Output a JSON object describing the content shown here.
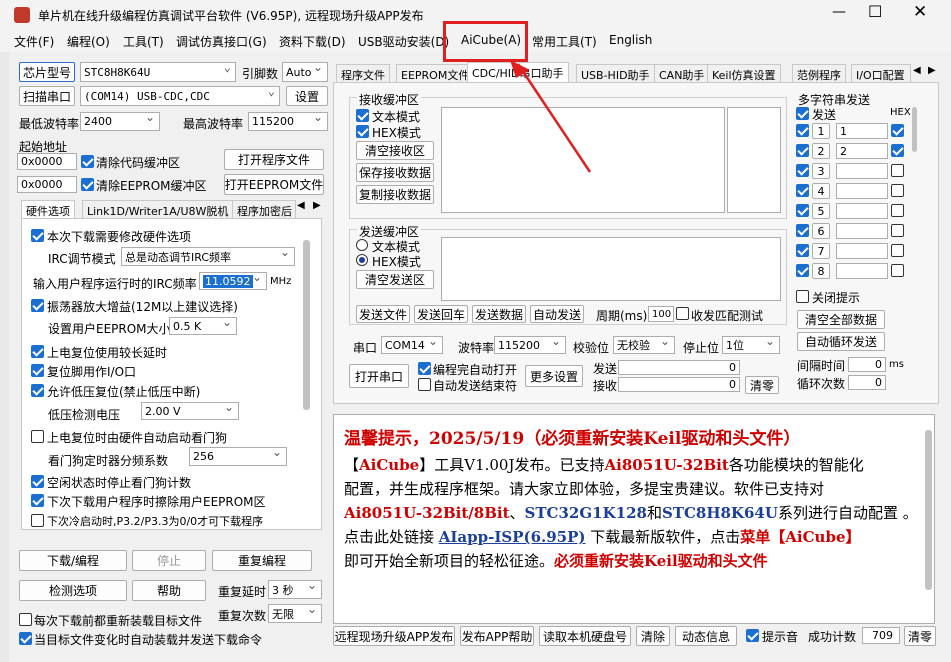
{
  "title": "单片机在线升级编程仿真调试平台软件 (V6.95P), 远程现场升级APP发布",
  "menu": [
    "文件(F)",
    "编程(O)",
    "工具(T)",
    "调试仿真接口(G)",
    "资料下载(D)",
    "USB驱动安装(D)",
    "AiCube(A)",
    "常用工具(T)",
    "English"
  ],
  "left": {
    "chip_btn": "芯片型号",
    "chip": "STC8H8K64U",
    "pin_lbl": "引脚数",
    "pin": "Auto",
    "scan_btn": "扫描串口",
    "port": "(COM14) USB-CDC,CDC",
    "settings_btn": "设置",
    "min_baud_lbl": "最低波特率",
    "min_baud": "2400",
    "max_baud_lbl": "最高波特率",
    "max_baud": "115200",
    "start_addr": "起始地址",
    "addr1": "0x0000",
    "clr_code": "清除代码缓冲区",
    "open_prog": "打开程序文件",
    "addr2": "0x0000",
    "clr_eeprom": "清除EEPROM缓冲区",
    "open_eeprom": "打开EEPROM文件",
    "tabs": [
      "硬件选项",
      "Link1D/Writer1A/U8W脱机",
      "程序加密后"
    ],
    "opt1": "本次下载需要修改硬件选项",
    "irc_lbl": "IRC调节模式",
    "irc": "总是动态调节IRC频率",
    "freq_lbl": "输入用户程序运行时的IRC频率",
    "freq": "11.0592",
    "mhz": "MHz",
    "opt_osc": "振荡器放大增益(12M以上建议选择)",
    "eep_lbl": "设置用户EEPROM大小",
    "eep": "0.5 K",
    "opt_reset": "上电复位使用较长延时",
    "opt_io": "复位脚用作I/O口",
    "opt_lv": "允许低压复位(禁止低压中断)",
    "lv_lbl": "低压检测电压",
    "lv": "2.00 V",
    "opt_wdt": "上电复位时由硬件自动启动看门狗",
    "wdt_lbl": "看门狗定时器分频系数",
    "wdt": "256",
    "opt_idle": "空闲状态时停止看门狗计数",
    "opt_erase": "下次下载用户程序时擦除用户EEPROM区",
    "opt_p3": "下次冷启动时,P3.2/P3.3为0/0才可下载程序",
    "dl_btn": "下载/编程",
    "stop_btn": "停止",
    "redl_btn": "重复编程",
    "check_btn": "检测选项",
    "help_btn": "帮助",
    "delay_lbl": "重复延时",
    "delay": "3 秒",
    "count_lbl": "重复次数",
    "count": "无限",
    "reload": "每次下载前都重新装载目标文件",
    "autoload": "当目标文件变化时自动装载并发送下载命令"
  },
  "right": {
    "tabs": [
      "程序文件",
      "EEPROM文件",
      "CDC/HID串口助手",
      "USB-HID助手",
      "CAN助手",
      "Keil仿真设置",
      "范例程序",
      "I/O口配置"
    ],
    "rx_title": "接收缓冲区",
    "text_mode": "文本模式",
    "hex_mode": "HEX模式",
    "clr_rx": "清空接收区",
    "save_rx": "保存接收数据",
    "copy_rx": "复制接收数据",
    "tx_title": "发送缓冲区",
    "clr_tx": "清空发送区",
    "send_file": "发送文件",
    "send_enter": "发送回车",
    "send_data": "发送数据",
    "auto_send": "自动发送",
    "period_lbl": "周期(ms)",
    "period": "100",
    "match": "收发匹配测试",
    "port_lbl": "串口",
    "port": "COM14",
    "baud_lbl": "波特率",
    "baud": "115200",
    "parity_lbl": "校验位",
    "parity": "无校验",
    "stop_lbl": "停止位",
    "stop": "1位",
    "open_port": "打开串口",
    "auto_open": "编程完自动打开",
    "auto_send_end": "自动发送结束符",
    "more": "更多设置",
    "sent_lbl": "发送",
    "sent": "0",
    "recv_lbl": "接收",
    "recv": "0",
    "clear": "清零",
    "multi_title": "多字符串发送",
    "send_col": "发送",
    "hex_col": "HEX",
    "rows": [
      "1",
      "2",
      "3",
      "4",
      "5",
      "6",
      "7",
      "8"
    ],
    "vals": [
      "1",
      "2",
      "",
      "",
      "",
      "",
      "",
      ""
    ],
    "close_tip": "关闭提示",
    "clr_all": "清空全部数据",
    "auto_loop": "自动循环发送",
    "interval_lbl": "间隔时间",
    "interval": "0",
    "ms": "ms",
    "loop_lbl": "循环次数",
    "loop": "0"
  },
  "notice": {
    "head": "温馨提示，2025/5/19（必须重新安装Keil驱动和头文件）",
    "l1a": "【",
    "l1b": "AiCube",
    "l1c": "】工具V1.00J发布。已支持",
    "l1d": "Ai8051U-32Bit",
    "l1e": "各功能模块的智能化",
    "l2": "配置，并生成程序框架。请大家立即体验，多提宝贵建议。软件已支持对",
    "l3a": "Ai8051U-32Bit/8Bit",
    "l3b": "、",
    "l3c": "STC32G1K128",
    "l3d": "和",
    "l3e": "STC8H8K64U",
    "l3f": "系列进行自动配置 。",
    "l4a": "点击此处链接 ",
    "l4b": "AIapp-ISP(6.95P)",
    "l4c": " 下载最新版软件，点击",
    "l4d": "菜单【AiCube】",
    "l5a": "即可开始全新项目的轻松征途。",
    "l5b": "必须重新安装Keil驱动和头文件"
  },
  "bottom": {
    "remote": "远程现场升级APP发布",
    "publish_help": "发布APP帮助",
    "read_disk": "读取本机硬盘号",
    "clr": "清除",
    "animation": "动态信息",
    "beep": "提示音",
    "success_lbl": "成功计数",
    "success": "709",
    "clr2": "清零"
  }
}
